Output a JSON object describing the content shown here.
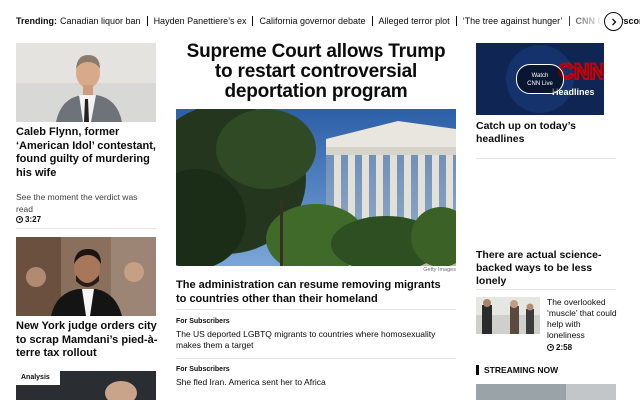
{
  "trending": {
    "label": "Trending:",
    "items": [
      "Canadian liquor ban",
      "Hayden Panettiere’s ex",
      "California governor debate",
      "Alleged terror plot",
      "‘The tree against hunger’",
      "CNN Underscored"
    ]
  },
  "left": {
    "story1": {
      "headline": "Caleb Flynn, former ‘American Idol’ contestant, found guilty of murdering his wife",
      "sub": "See the moment the verdict was read",
      "duration": "3:27"
    },
    "story2": {
      "headline": "New York judge orders city to scrap Mamdani’s pied-à-terre tax rollout"
    },
    "story3": {
      "badge": "Analysis"
    }
  },
  "center": {
    "title": "Supreme Court allows Trump to restart controversial deportation program",
    "credit": "Getty Images",
    "lead": "The administration can resume removing migrants to countries other than their homeland",
    "sub1": {
      "label": "For Subscribers",
      "text": "The US deported LGBTQ migrants to countries where homosexuality makes them a target"
    },
    "sub2": {
      "label": "For Subscribers",
      "text": "She fled Iran. America sent her to Africa"
    }
  },
  "right": {
    "live": {
      "watch": "Watch",
      "channel": "CNN Live",
      "screen_text": "Headlines",
      "headline": "Catch up on today’s headlines"
    },
    "story2": {
      "headline": "There are actual science-backed ways to be less lonely"
    },
    "story3": {
      "headline": "The overlooked ‘muscle’ that could help with loneliness",
      "duration": "2:58"
    },
    "streaming": "STREAMING NOW"
  },
  "colors": {
    "cnn_red": "#cc0000",
    "text": "#0c0c0c",
    "divider": "#e6e6e6"
  }
}
